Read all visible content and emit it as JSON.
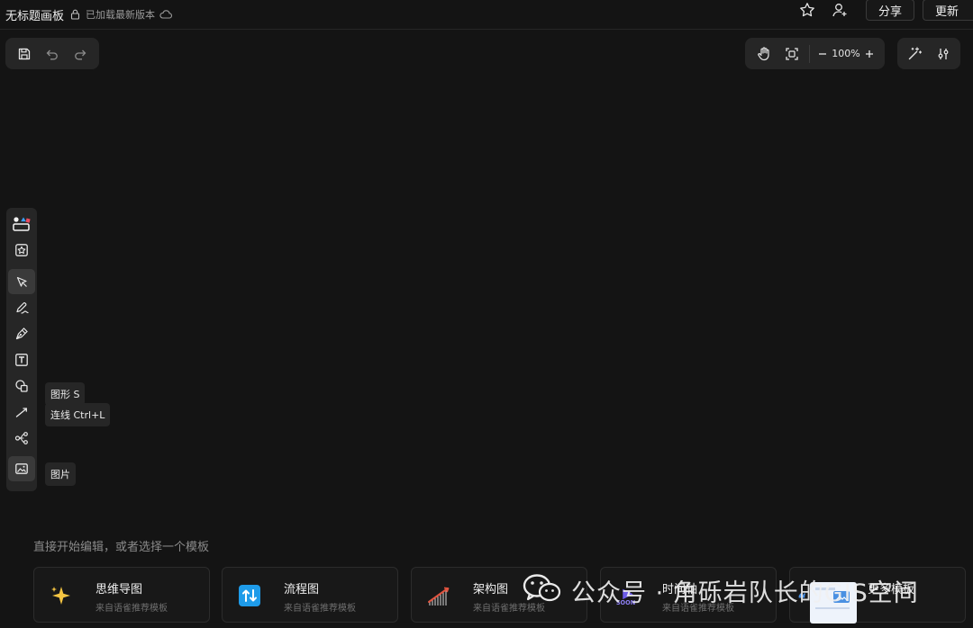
{
  "header": {
    "title": "无标题画板",
    "status": "已加载最新版本",
    "share_label": "分享",
    "update_label": "更新"
  },
  "zoom": {
    "level": "100%"
  },
  "tools": [
    {
      "name": "template-library",
      "icon": "shapes-palette-icon"
    },
    {
      "name": "stickers",
      "icon": "star-frame-icon"
    },
    {
      "name": "select",
      "icon": "cursor-icon",
      "active": true
    },
    {
      "name": "pencil",
      "icon": "pencil-icon"
    },
    {
      "name": "pen",
      "icon": "pen-nib-icon"
    },
    {
      "name": "text",
      "icon": "text-icon"
    },
    {
      "name": "shape",
      "icon": "shapes-icon"
    },
    {
      "name": "connector",
      "icon": "line-icon"
    },
    {
      "name": "mindmap",
      "icon": "mindmap-icon"
    },
    {
      "name": "image",
      "icon": "image-icon"
    }
  ],
  "tooltips": {
    "shape": "图形 S",
    "connector": "连线 Ctrl+L",
    "image": "图片"
  },
  "hint": "直接开始编辑，或者选择一个模板",
  "templates": [
    {
      "title": "思维导图",
      "subtitle": "来自语雀推荐模板",
      "icon": "sparkle-icon",
      "color": "#f5c542"
    },
    {
      "title": "流程图",
      "subtitle": "来自语雀推荐模板",
      "icon": "flowchart-icon",
      "color": "#1e9be9"
    },
    {
      "title": "架构图",
      "subtitle": "来自语雀推荐模板",
      "icon": "architecture-icon",
      "color": "#e0533f"
    },
    {
      "title": "时间轴",
      "subtitle": "来自语雀推荐模板",
      "icon": "soon-icon",
      "color": "#6c5ce7"
    },
    {
      "title": "更多模板",
      "subtitle": "",
      "icon": "more-templates-icon",
      "color": "#4a90e2"
    }
  ],
  "watermark": {
    "text": "公众号 · 角砾岩队长的GIS空间"
  }
}
